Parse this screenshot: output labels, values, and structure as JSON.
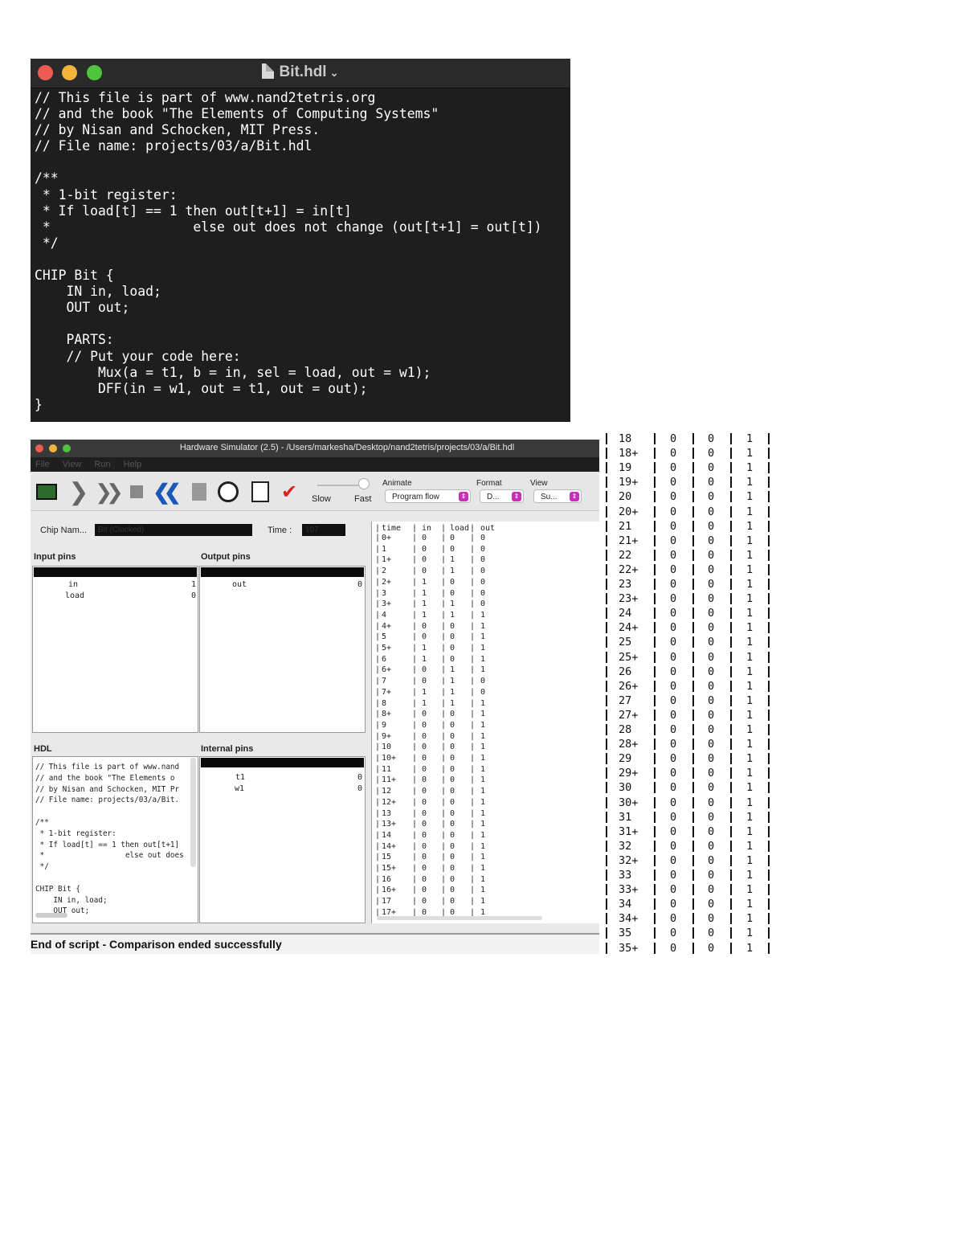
{
  "editor": {
    "title": "Bit.hdl",
    "code": "// This file is part of www.nand2tetris.org\n// and the book \"The Elements of Computing Systems\"\n// by Nisan and Schocken, MIT Press.\n// File name: projects/03/a/Bit.hdl\n\n/**\n * 1-bit register:\n * If load[t] == 1 then out[t+1] = in[t]\n *                  else out does not change (out[t+1] = out[t])\n */\n\nCHIP Bit {\n    IN in, load;\n    OUT out;\n\n    PARTS:\n    // Put your code here:\n        Mux(a = t1, b = in, sel = load, out = w1);\n        DFF(in = w1, out = t1, out = out);\n}"
  },
  "simulator": {
    "window_title": "Hardware Simulator (2.5) - /Users/markesha/Desktop/nand2tetris/projects/03/a/Bit.hdl",
    "menu": [
      "File",
      "View",
      "Run",
      "Help"
    ],
    "speed": {
      "slow_label": "Slow",
      "fast_label": "Fast"
    },
    "animate": {
      "label": "Animate",
      "value": "Program flow"
    },
    "format": {
      "label": "Format",
      "value": "D..."
    },
    "view": {
      "label": "View",
      "value": "Su..."
    },
    "chip_name_label": "Chip Nam...",
    "chip_name_value": "Bit (Clocked)",
    "time_label": "Time :",
    "time_value": "107",
    "input_pins_header": "Input pins",
    "output_pins_header": "Output pins",
    "input_pins": [
      {
        "name": "in",
        "value": "1"
      },
      {
        "name": "load",
        "value": "0"
      }
    ],
    "output_pins": [
      {
        "name": "out",
        "value": "0"
      }
    ],
    "hdl_header": "HDL",
    "hdl_code": "// This file is part of www.nand\n// and the book \"The Elements o\n// by Nisan and Schocken, MIT Pr\n// File name: projects/03/a/Bit.\n\n/**\n * 1-bit register:\n * If load[t] == 1 then out[t+1]\n *                  else out does\n */\n\nCHIP Bit {\n    IN in, load;\n    OUT out;",
    "internal_pins_header": "Internal pins",
    "internal_pins": [
      {
        "name": "t1",
        "value": "0"
      },
      {
        "name": "w1",
        "value": "0"
      }
    ],
    "output_table": {
      "headers": [
        "time",
        "in",
        "load",
        "out"
      ],
      "rows": [
        [
          "0+",
          "0",
          "0",
          "0"
        ],
        [
          "1",
          "0",
          "0",
          "0"
        ],
        [
          "1+",
          "0",
          "1",
          "0"
        ],
        [
          "2",
          "0",
          "1",
          "0"
        ],
        [
          "2+",
          "1",
          "0",
          "0"
        ],
        [
          "3",
          "1",
          "0",
          "0"
        ],
        [
          "3+",
          "1",
          "1",
          "0"
        ],
        [
          "4",
          "1",
          "1",
          "1"
        ],
        [
          "4+",
          "0",
          "0",
          "1"
        ],
        [
          "5",
          "0",
          "0",
          "1"
        ],
        [
          "5+",
          "1",
          "0",
          "1"
        ],
        [
          "6",
          "1",
          "0",
          "1"
        ],
        [
          "6+",
          "0",
          "1",
          "1"
        ],
        [
          "7",
          "0",
          "1",
          "0"
        ],
        [
          "7+",
          "1",
          "1",
          "0"
        ],
        [
          "8",
          "1",
          "1",
          "1"
        ],
        [
          "8+",
          "0",
          "0",
          "1"
        ],
        [
          "9",
          "0",
          "0",
          "1"
        ],
        [
          "9+",
          "0",
          "0",
          "1"
        ],
        [
          "10",
          "0",
          "0",
          "1"
        ],
        [
          "10+",
          "0",
          "0",
          "1"
        ],
        [
          "11",
          "0",
          "0",
          "1"
        ],
        [
          "11+",
          "0",
          "0",
          "1"
        ],
        [
          "12",
          "0",
          "0",
          "1"
        ],
        [
          "12+",
          "0",
          "0",
          "1"
        ],
        [
          "13",
          "0",
          "0",
          "1"
        ],
        [
          "13+",
          "0",
          "0",
          "1"
        ],
        [
          "14",
          "0",
          "0",
          "1"
        ],
        [
          "14+",
          "0",
          "0",
          "1"
        ],
        [
          "15",
          "0",
          "0",
          "1"
        ],
        [
          "15+",
          "0",
          "0",
          "1"
        ],
        [
          "16",
          "0",
          "0",
          "1"
        ],
        [
          "16+",
          "0",
          "0",
          "1"
        ],
        [
          "17",
          "0",
          "0",
          "1"
        ],
        [
          "17+",
          "0",
          "0",
          "1"
        ]
      ]
    },
    "status": "End of script - Comparison ended successfully"
  },
  "right_table": [
    [
      "18",
      "0",
      "0",
      "1"
    ],
    [
      "18+",
      "0",
      "0",
      "1"
    ],
    [
      "19",
      "0",
      "0",
      "1"
    ],
    [
      "19+",
      "0",
      "0",
      "1"
    ],
    [
      "20",
      "0",
      "0",
      "1"
    ],
    [
      "20+",
      "0",
      "0",
      "1"
    ],
    [
      "21",
      "0",
      "0",
      "1"
    ],
    [
      "21+",
      "0",
      "0",
      "1"
    ],
    [
      "22",
      "0",
      "0",
      "1"
    ],
    [
      "22+",
      "0",
      "0",
      "1"
    ],
    [
      "23",
      "0",
      "0",
      "1"
    ],
    [
      "23+",
      "0",
      "0",
      "1"
    ],
    [
      "24",
      "0",
      "0",
      "1"
    ],
    [
      "24+",
      "0",
      "0",
      "1"
    ],
    [
      "25",
      "0",
      "0",
      "1"
    ],
    [
      "25+",
      "0",
      "0",
      "1"
    ],
    [
      "26",
      "0",
      "0",
      "1"
    ],
    [
      "26+",
      "0",
      "0",
      "1"
    ],
    [
      "27",
      "0",
      "0",
      "1"
    ],
    [
      "27+",
      "0",
      "0",
      "1"
    ],
    [
      "28",
      "0",
      "0",
      "1"
    ],
    [
      "28+",
      "0",
      "0",
      "1"
    ],
    [
      "29",
      "0",
      "0",
      "1"
    ],
    [
      "29+",
      "0",
      "0",
      "1"
    ],
    [
      "30",
      "0",
      "0",
      "1"
    ],
    [
      "30+",
      "0",
      "0",
      "1"
    ],
    [
      "31",
      "0",
      "0",
      "1"
    ],
    [
      "31+",
      "0",
      "0",
      "1"
    ],
    [
      "32",
      "0",
      "0",
      "1"
    ],
    [
      "32+",
      "0",
      "0",
      "1"
    ],
    [
      "33",
      "0",
      "0",
      "1"
    ],
    [
      "33+",
      "0",
      "0",
      "1"
    ],
    [
      "34",
      "0",
      "0",
      "1"
    ],
    [
      "34+",
      "0",
      "0",
      "1"
    ],
    [
      "35",
      "0",
      "0",
      "1"
    ],
    [
      "35+",
      "0",
      "0",
      "1"
    ]
  ],
  "colors": {
    "editor_bg": "#1e1e1e",
    "accent": "#c82fb8",
    "close": "#ee5b52",
    "minimize": "#f4b43a",
    "zoom": "#4ec63b"
  }
}
